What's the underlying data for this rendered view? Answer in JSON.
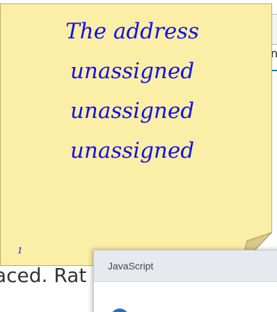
{
  "sticky_note": {
    "lines": [
      "The address",
      "unassigned",
      "unassigned",
      "unassigned"
    ],
    "number": "1"
  },
  "background_page": {
    "partial_text": "aced. Rat",
    "partial_letter": "n"
  },
  "dialog": {
    "title": "JavaScript",
    "icon": "info-icon"
  },
  "colors": {
    "note_fill": "#fbeea6",
    "note_text": "#1010f0",
    "dialog_titlebar": "#e6eaee",
    "dialog_icon": "#1f6fc5"
  }
}
